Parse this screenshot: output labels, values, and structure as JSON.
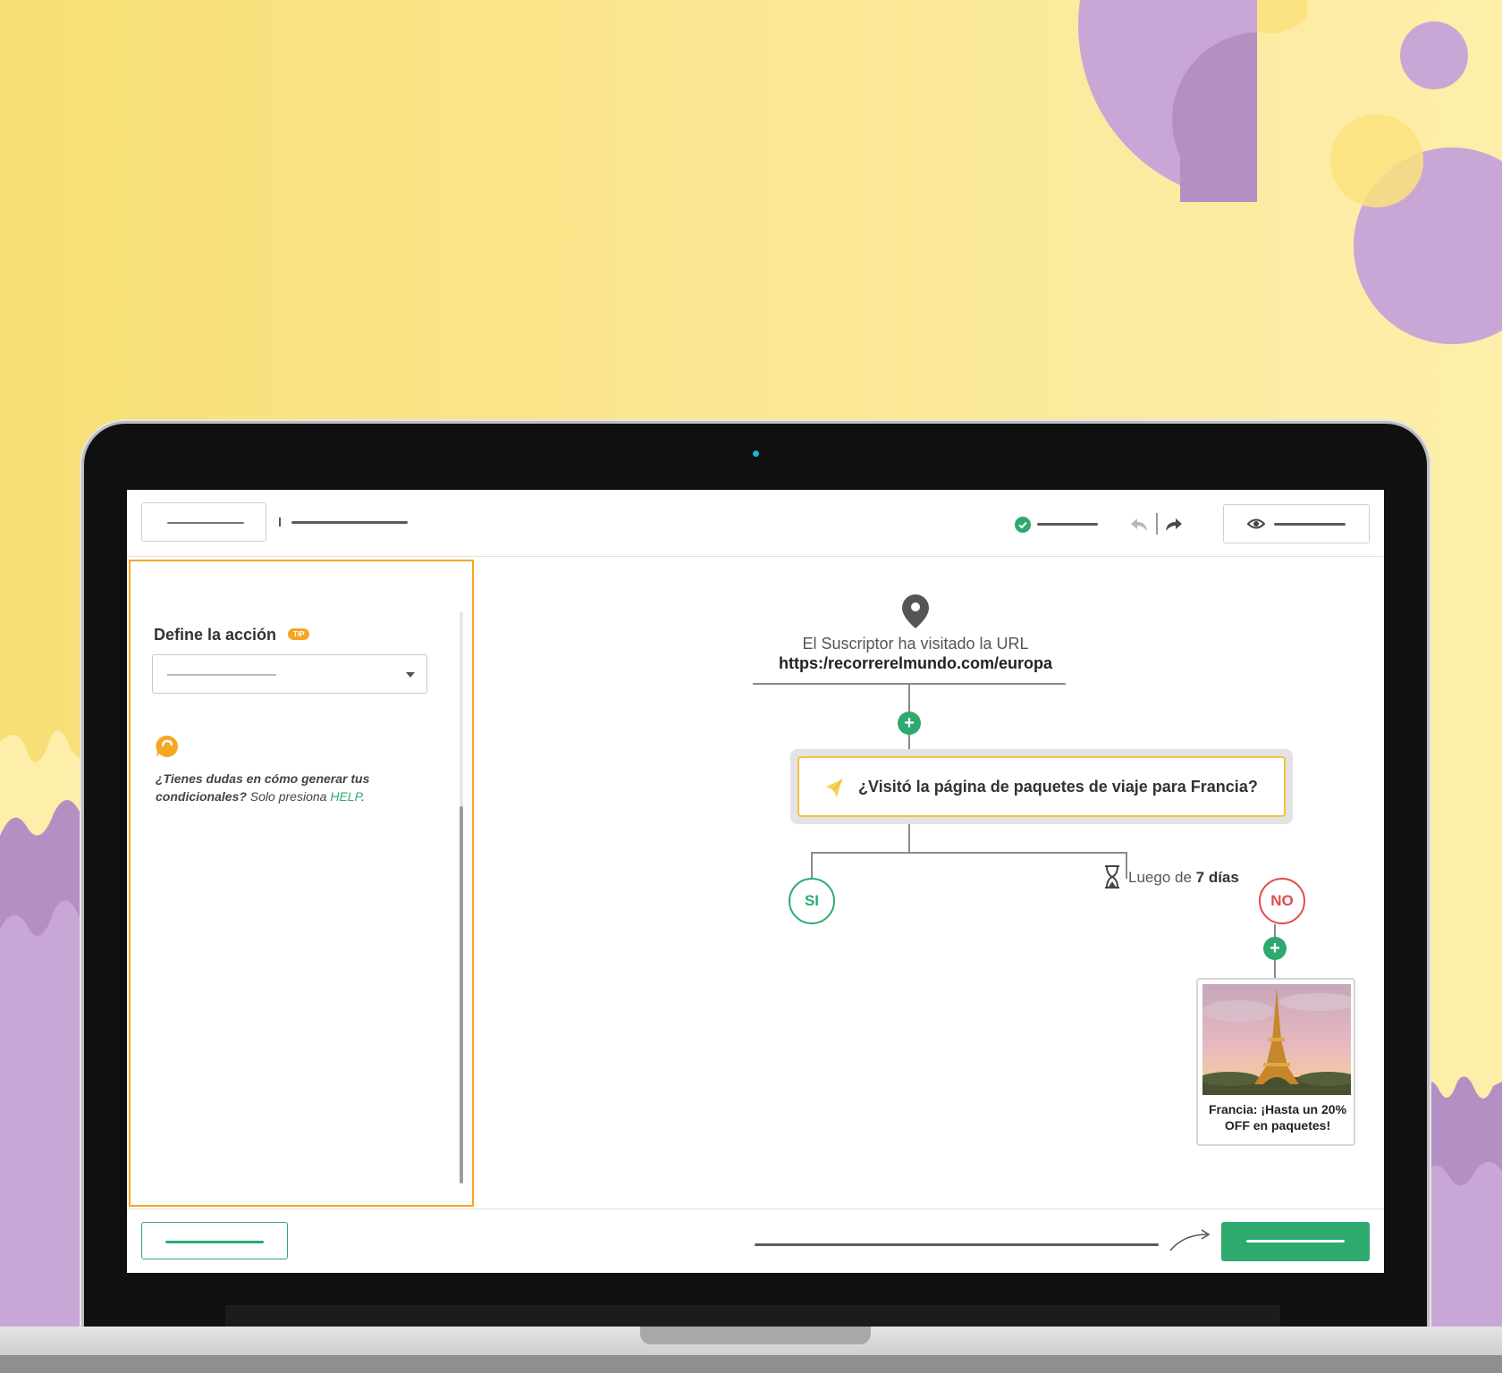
{
  "toolbar": {
    "left_button": "",
    "status_icon": "check-circle-icon",
    "undo_icon": "undo-icon",
    "redo_icon": "redo-icon",
    "preview_icon": "eye-icon"
  },
  "sidebar": {
    "title": "Define la acción",
    "tip_badge": "TIP",
    "select_value": "",
    "help_icon": "help-bubble-icon",
    "help_question": "¿Tienes dudas en cómo generar tus condicionales?",
    "help_prefix": " Solo presiona ",
    "help_link": "HELP",
    "help_suffix": "."
  },
  "flow": {
    "trigger_icon": "location-pin-icon",
    "trigger_text": "El Suscriptor ha visitado la URL",
    "trigger_url": "https:/recorrerelmundo.com/europa",
    "condition_icon": "condition-icon",
    "condition_text": "¿Visitó la página de paquetes de viaje para Francia?",
    "yes_label": "SI",
    "no_label": "NO",
    "delay_prefix": "Luego de ",
    "delay_value": "7 días",
    "email_caption_line1": "Francia: ¡Hasta un 20%",
    "email_caption_line2": "OFF en paquetes!"
  },
  "colors": {
    "accent_green": "#2eaa6e",
    "accent_orange": "#f5a623",
    "no_red": "#e24b4b",
    "background_yellow": "#f8de74",
    "decor_purple": "#c8a7d6"
  }
}
